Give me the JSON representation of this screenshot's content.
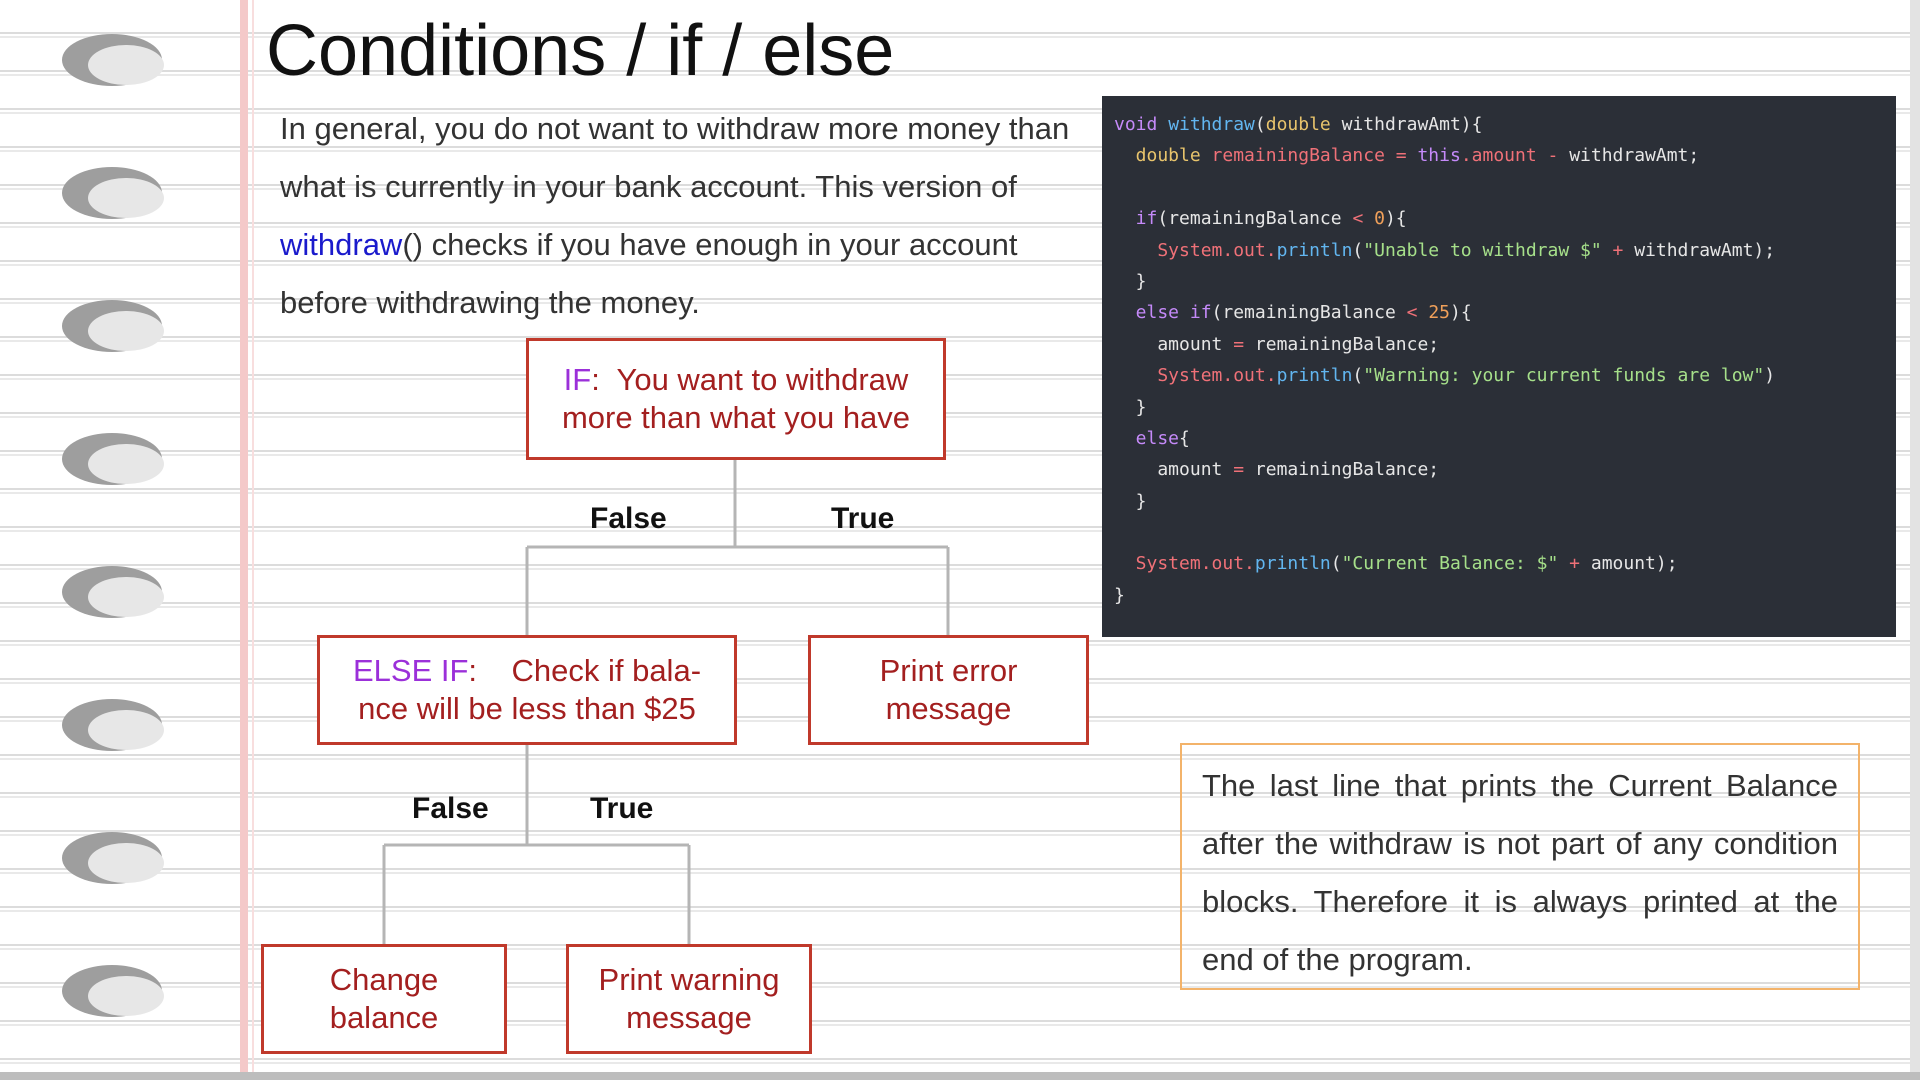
{
  "title": "Conditions / if / else",
  "intro": {
    "before": "In general, you do not want to withdraw more money than what is currently in your bank account. This version of ",
    "keyword": "withdraw",
    "after": "() checks if you have enough in your account before withdrawing the money."
  },
  "code": {
    "lines": [
      [
        {
          "t": "void ",
          "c": "k"
        },
        {
          "t": "withdraw",
          "c": "f"
        },
        {
          "t": "(",
          "c": "p"
        },
        {
          "t": "double ",
          "c": "t"
        },
        {
          "t": "withdrawAmt){",
          "c": "p"
        }
      ],
      [
        {
          "t": "  double ",
          "c": "t"
        },
        {
          "t": "remainingBalance",
          "c": "v"
        },
        {
          "t": " = ",
          "c": "o"
        },
        {
          "t": "this",
          "c": "k"
        },
        {
          "t": ".amount",
          "c": "v"
        },
        {
          "t": " - ",
          "c": "o"
        },
        {
          "t": "withdrawAmt;",
          "c": "p"
        }
      ],
      [],
      [
        {
          "t": "  if",
          "c": "k"
        },
        {
          "t": "(remainingBalance ",
          "c": "p"
        },
        {
          "t": "< ",
          "c": "o"
        },
        {
          "t": "0",
          "c": "n"
        },
        {
          "t": "){",
          "c": "p"
        }
      ],
      [
        {
          "t": "    System",
          "c": "v"
        },
        {
          "t": ".out.",
          "c": "v"
        },
        {
          "t": "println",
          "c": "f"
        },
        {
          "t": "(",
          "c": "p"
        },
        {
          "t": "\"Unable to withdraw $\"",
          "c": "s"
        },
        {
          "t": " + ",
          "c": "o"
        },
        {
          "t": "withdrawAmt);",
          "c": "p"
        }
      ],
      [
        {
          "t": "  }",
          "c": "p"
        }
      ],
      [
        {
          "t": "  else if",
          "c": "k"
        },
        {
          "t": "(remainingBalance ",
          "c": "p"
        },
        {
          "t": "< ",
          "c": "o"
        },
        {
          "t": "25",
          "c": "n"
        },
        {
          "t": "){",
          "c": "p"
        }
      ],
      [
        {
          "t": "    amount ",
          "c": "p"
        },
        {
          "t": "= ",
          "c": "o"
        },
        {
          "t": "remainingBalance;",
          "c": "p"
        }
      ],
      [
        {
          "t": "    System",
          "c": "v"
        },
        {
          "t": ".out.",
          "c": "v"
        },
        {
          "t": "println",
          "c": "f"
        },
        {
          "t": "(",
          "c": "p"
        },
        {
          "t": "\"Warning: your current funds are low\"",
          "c": "s"
        },
        {
          "t": ")",
          "c": "p"
        }
      ],
      [
        {
          "t": "  }",
          "c": "p"
        }
      ],
      [
        {
          "t": "  else",
          "c": "k"
        },
        {
          "t": "{",
          "c": "p"
        }
      ],
      [
        {
          "t": "    amount ",
          "c": "p"
        },
        {
          "t": "= ",
          "c": "o"
        },
        {
          "t": "remainingBalance;",
          "c": "p"
        }
      ],
      [
        {
          "t": "  }",
          "c": "p"
        }
      ],
      [],
      [
        {
          "t": "  System",
          "c": "v"
        },
        {
          "t": ".out.",
          "c": "v"
        },
        {
          "t": "println",
          "c": "f"
        },
        {
          "t": "(",
          "c": "p"
        },
        {
          "t": "\"Current Balance: $\"",
          "c": "s"
        },
        {
          "t": " + ",
          "c": "o"
        },
        {
          "t": "amount);",
          "c": "p"
        }
      ],
      [
        {
          "t": "}",
          "c": "p"
        }
      ]
    ]
  },
  "flow": {
    "if_box": {
      "keyword": "IF",
      "line1": ":  You want to withdraw",
      "line2": "more than what you have"
    },
    "branch1_false": "False",
    "branch1_true": "True",
    "elseif_box": {
      "keyword": "ELSE IF",
      "line1": ":    Check if bala-",
      "line2": "nce will be less than $25"
    },
    "error_box": {
      "line1": "Print error",
      "line2": "message"
    },
    "branch2_false": "False",
    "branch2_true": "True",
    "change_box": {
      "line1": "Change",
      "line2": "balance"
    },
    "warning_box": {
      "line1": "Print warning",
      "line2": "message"
    }
  },
  "note": "The last line that prints the Current Balance after the withdraw is not part of any condition blocks. Therefore it is always printed at the end of the program.",
  "colors": {
    "box_border": "#c0392b",
    "box_text": "#a31f1f",
    "keyword_purple": "#9b30d9",
    "link_blue": "#1a1acc",
    "code_bg": "#2b2f37",
    "note_border": "#f3b36a"
  }
}
